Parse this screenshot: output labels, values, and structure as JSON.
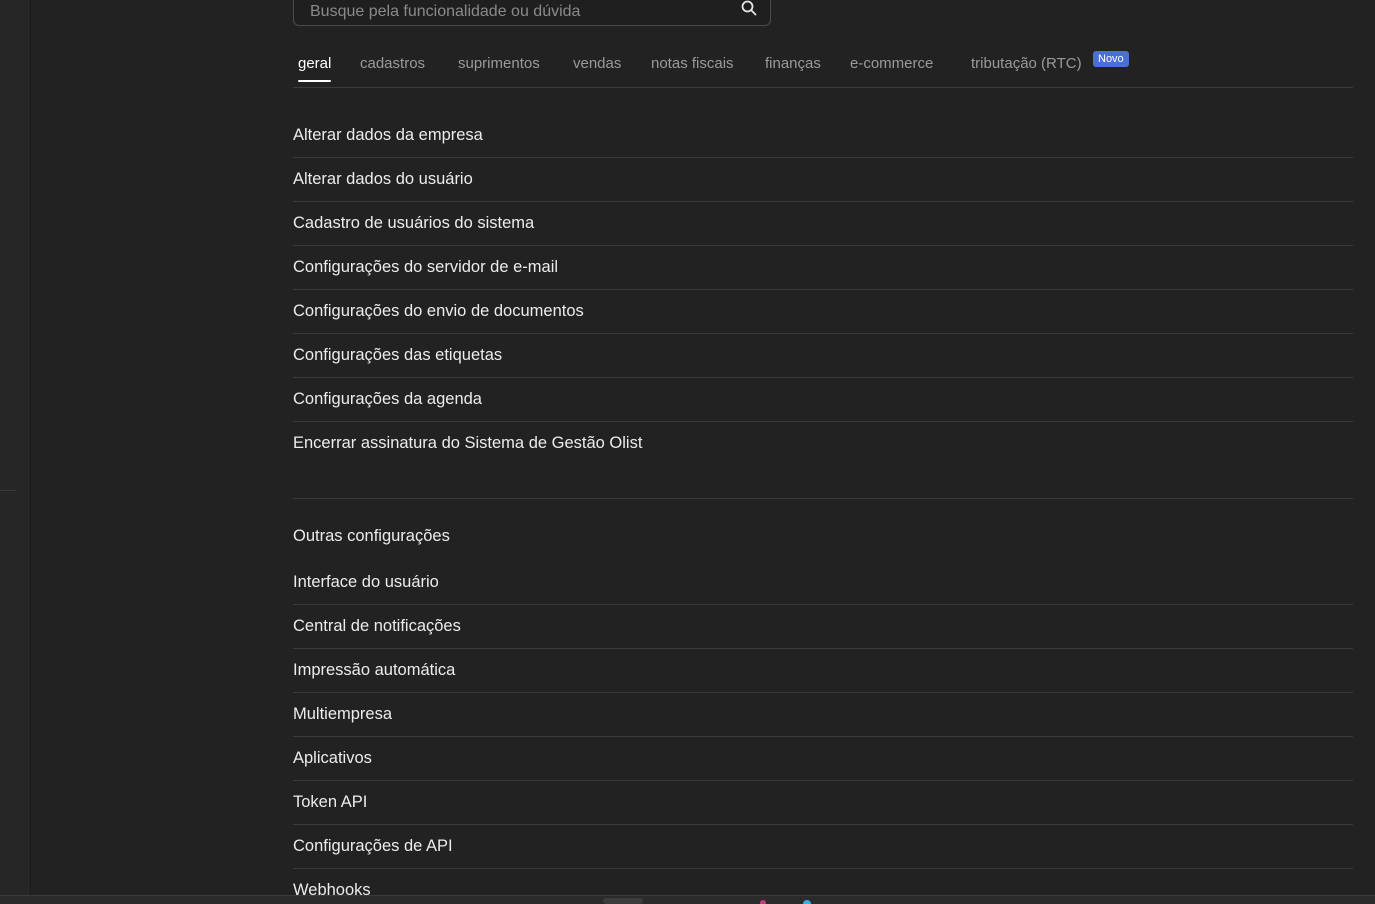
{
  "search": {
    "placeholder": "Busque pela funcionalidade ou dúvida"
  },
  "tabs": [
    {
      "label": "geral",
      "active": true
    },
    {
      "label": "cadastros"
    },
    {
      "label": "suprimentos"
    },
    {
      "label": "vendas"
    },
    {
      "label": "notas fiscais"
    },
    {
      "label": "finanças"
    },
    {
      "label": "e-commerce"
    },
    {
      "label": "tributação (RTC)",
      "badge": "Novo"
    }
  ],
  "general_settings": [
    "Alterar dados da empresa",
    "Alterar dados do usuário",
    "Cadastro de usuários do sistema",
    "Configurações do servidor de e-mail",
    "Configurações do envio de documentos",
    "Configurações das etiquetas",
    "Configurações da agenda",
    "Encerrar assinatura do Sistema de Gestão Olist"
  ],
  "other_settings": {
    "title": "Outras configurações",
    "items": [
      "Interface do usuário",
      "Central de notificações",
      "Impressão automática",
      "Multiempresa",
      "Aplicativos",
      "Token API",
      "Configurações de API",
      "Webhooks"
    ]
  },
  "colors": {
    "background": "#222222",
    "badge": "#4a6fd6",
    "divider": "#3a3a3a"
  }
}
